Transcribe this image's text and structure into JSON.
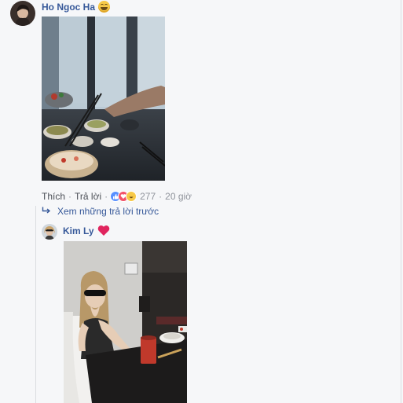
{
  "comment": {
    "author": "Ho Ngoc Ha",
    "actions": {
      "like": "Thích",
      "reply": "Trả lời",
      "reaction_count": "277",
      "time": "20 giờ"
    }
  },
  "thread": {
    "view_previous": "Xem những trả lời trước"
  },
  "reply": {
    "author": "Kim Ly"
  },
  "icons": {
    "author_emoji": "grinning-squinting-face-icon",
    "reply_emoji": "red-heart-icon",
    "reply_arrow": "reply-arrow-icon"
  },
  "colors": {
    "name_blue": "#365899",
    "link_gray": "#4b4f56",
    "muted_gray": "#90949c",
    "background": "#f6f7f9"
  }
}
